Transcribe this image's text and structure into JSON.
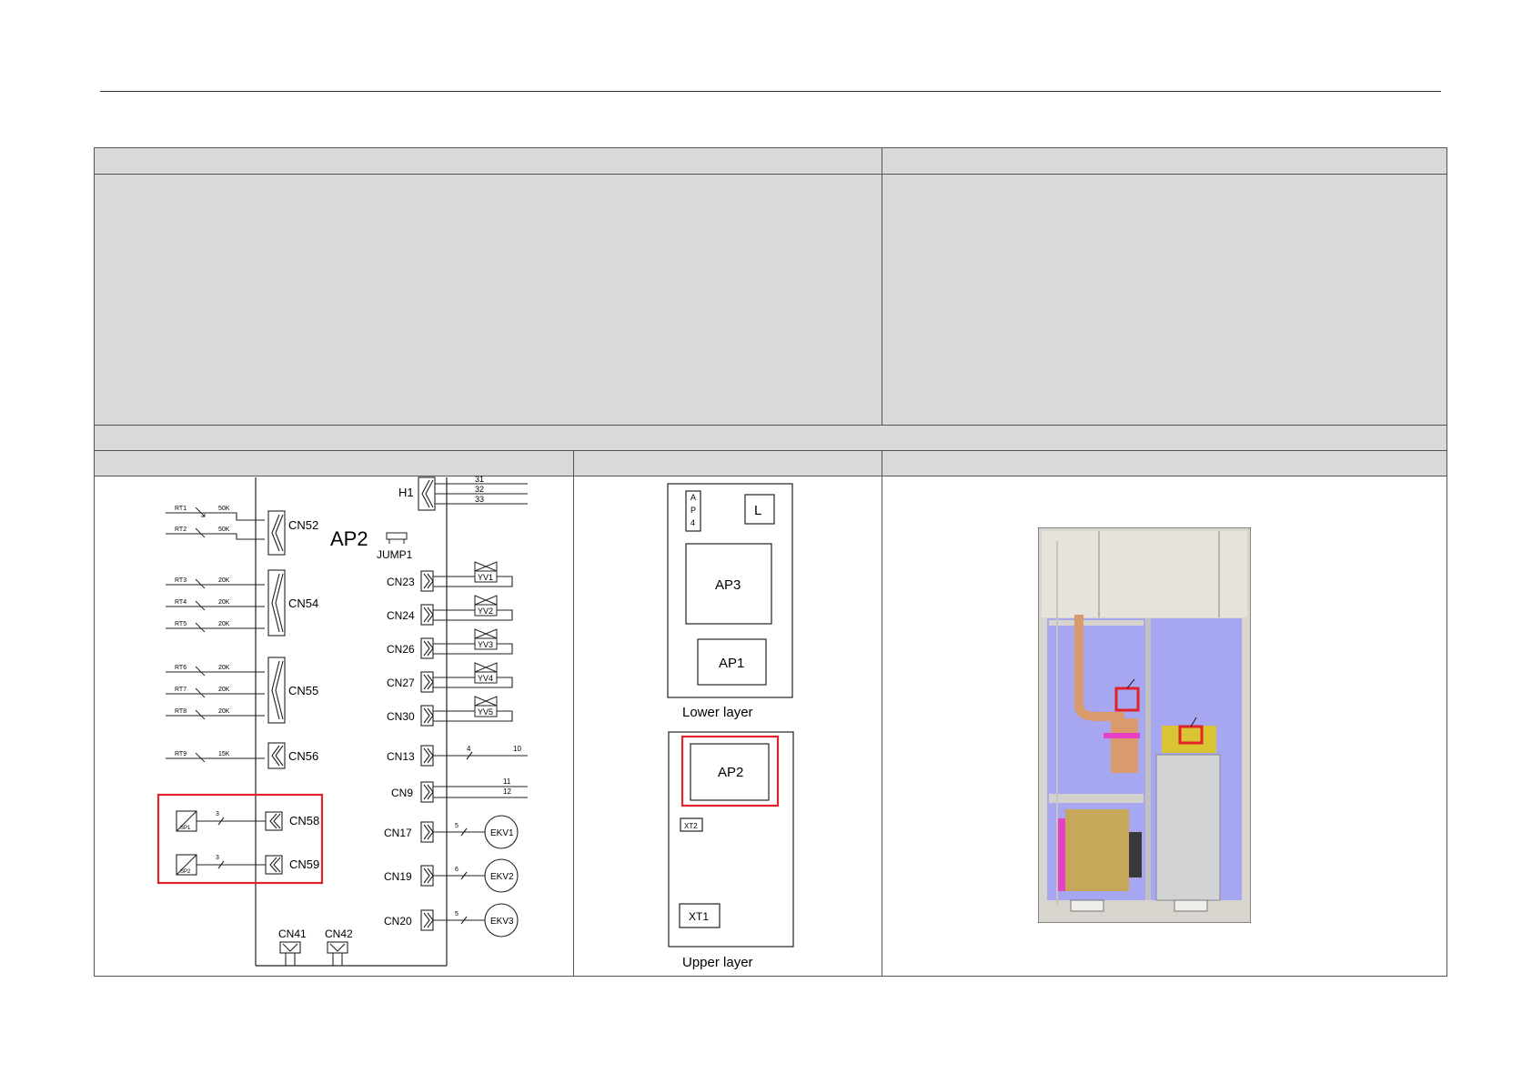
{
  "board_label": "AP2",
  "jumper_label": "JUMP1",
  "h1": {
    "label": "H1",
    "pins": [
      "31",
      "32",
      "33"
    ]
  },
  "sensor_groups": [
    {
      "connector": "CN52",
      "sensors": [
        {
          "name": "RT1",
          "value": "50K"
        },
        {
          "name": "RT2",
          "value": "50K"
        }
      ]
    },
    {
      "connector": "CN54",
      "sensors": [
        {
          "name": "RT3",
          "value": "20K"
        },
        {
          "name": "RT4",
          "value": "20K"
        },
        {
          "name": "RT5",
          "value": "20K"
        }
      ]
    },
    {
      "connector": "CN55",
      "sensors": [
        {
          "name": "RT6",
          "value": "20K"
        },
        {
          "name": "RT7",
          "value": "20K"
        },
        {
          "name": "RT8",
          "value": "20K"
        }
      ]
    },
    {
      "connector": "CN56",
      "sensors": [
        {
          "name": "RT9",
          "value": "15K"
        }
      ]
    }
  ],
  "pressure_sensors": [
    {
      "name": "SP1",
      "wires": "3",
      "connector": "CN58"
    },
    {
      "name": "SP2",
      "wires": "3",
      "connector": "CN59"
    }
  ],
  "valves": [
    {
      "connector": "CN23",
      "name": "YV1"
    },
    {
      "connector": "CN24",
      "name": "YV2"
    },
    {
      "connector": "CN26",
      "name": "YV3"
    },
    {
      "connector": "CN27",
      "name": "YV4"
    },
    {
      "connector": "CN30",
      "name": "YV5"
    }
  ],
  "cn13": {
    "connector": "CN13",
    "wires": "4",
    "to": "10"
  },
  "cn9": {
    "connector": "CN9",
    "to_a": "11",
    "to_b": "12"
  },
  "expansion_valves": [
    {
      "connector": "CN17",
      "wires": "5",
      "name": "EKV1"
    },
    {
      "connector": "CN19",
      "wires": "6",
      "name": "EKV2"
    },
    {
      "connector": "CN20",
      "wires": "5",
      "name": "EKV3"
    }
  ],
  "bottom_connectors": [
    "CN41",
    "CN42"
  ],
  "layout_diagram": {
    "lower_layer": {
      "caption": "Lower layer",
      "ap4_letters": [
        "A",
        "P",
        "4"
      ],
      "l_label": "L",
      "ap3": "AP3",
      "ap1": "AP1"
    },
    "upper_layer": {
      "caption": "Upper layer",
      "ap2": "AP2",
      "xt2": "XT2",
      "xt1": "XT1"
    }
  },
  "colors": {
    "highlight": "#e0222a",
    "cell_header": "#d9d9d9",
    "unit_interior": "#a7a6f0"
  }
}
